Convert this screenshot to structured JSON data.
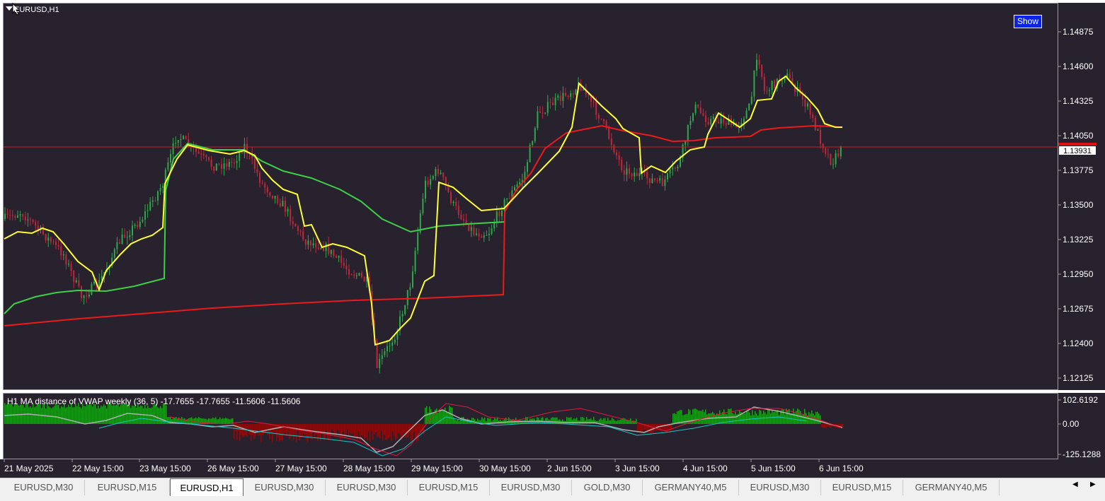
{
  "chart": {
    "title": "EURUSD,H1",
    "show_button": "Show",
    "current_price": "1.13931",
    "price_labels": [
      "1.14875",
      "1.14600",
      "1.14325",
      "1.14050",
      "1.13775",
      "1.13500",
      "1.13225",
      "1.12950",
      "1.12675",
      "1.12400",
      "1.12125"
    ],
    "colors": {
      "background": "#28222e",
      "bull": "#2ea84a",
      "bear": "#c0283a",
      "ma_yellow": "#ffff33",
      "vwap_green": "#3ecf48",
      "vwap_red": "#ee1a1a",
      "price_line": "#c81e1e"
    }
  },
  "indicator": {
    "title": "H1 MA distance of VWAP weekly (36,  5) -17.7655 -17.7655 -11.5606 -11.5606",
    "scale_labels": [
      "102.6192",
      "0.00",
      "-125.1288"
    ]
  },
  "time_labels": [
    "21 May 2025",
    "22 May 15:00",
    "23 May 15:00",
    "26 May 15:00",
    "27 May 15:00",
    "28 May 15:00",
    "29 May 15:00",
    "30 May 15:00",
    "2 Jun 15:00",
    "3 Jun 15:00",
    "4 Jun 15:00",
    "5 Jun 15:00",
    "6 Jun 15:00"
  ],
  "tabs": [
    {
      "label": "EURUSD,M30",
      "active": false
    },
    {
      "label": "EURUSD,M15",
      "active": false
    },
    {
      "label": "EURUSD,H1",
      "active": true
    },
    {
      "label": "EURUSD,M30",
      "active": false
    },
    {
      "label": "EURUSD,M30",
      "active": false
    },
    {
      "label": "EURUSD,M15",
      "active": false
    },
    {
      "label": "EURUSD,M30",
      "active": false
    },
    {
      "label": "GOLD,M30",
      "active": false
    },
    {
      "label": "GERMANY40,M5",
      "active": false
    },
    {
      "label": "EURUSD,M30",
      "active": false
    },
    {
      "label": "EURUSD,M15",
      "active": false
    },
    {
      "label": "GERMANY40,M5",
      "active": false
    }
  ],
  "icons": {
    "menu": "chart-menu-arrow-icon",
    "cursor": "mouse-cursor-icon",
    "scroll_left": "scroll-left-icon",
    "scroll_right": "scroll-right-icon"
  }
}
